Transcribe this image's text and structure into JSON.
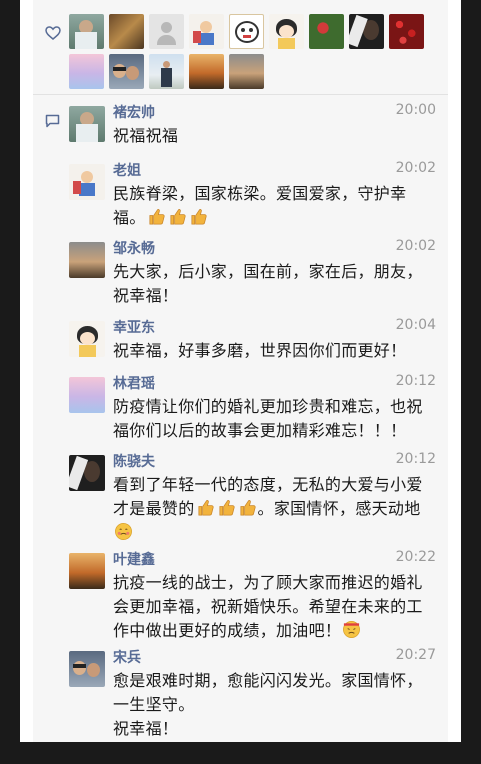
{
  "colors": {
    "name": "#576b95",
    "time": "#9a9a9a",
    "panel": "#f6f6f6",
    "accent": "#3a6fb5"
  },
  "likes": {
    "icon": "heart-outline-icon",
    "avatars": [
      "avatar-soccer-player",
      "avatar-horse-painting",
      "avatar-default-gray",
      "avatar-cartoon-superhero",
      "avatar-cartoon-face",
      "avatar-cartoon-girl",
      "avatar-red-flowers",
      "avatar-dark-portrait",
      "avatar-red-berries",
      "avatar-pastel-sky",
      "avatar-selfie-couple",
      "avatar-man-standing",
      "avatar-sunset-field",
      "avatar-cloudy-sunset"
    ]
  },
  "comments_icon": "comment-bubble-icon",
  "comments": [
    {
      "name": "褚宏帅",
      "time": "20:00",
      "lines": [
        "祝福祝福"
      ],
      "avatar": "avatar-soccer-player"
    },
    {
      "name": "老姐",
      "time": "20:02",
      "lines": [
        "民族脊梁，国家栋梁。爱国爱家，守护幸",
        "福。"
      ],
      "avatar": "avatar-cartoon-superhero",
      "emoji": "thumbs-up-emoji x3"
    },
    {
      "name": "邹永畅",
      "time": "20:02",
      "lines": [
        "先大家，后小家，国在前，家在后，朋友，",
        "祝幸福！"
      ],
      "avatar": "avatar-cloudy-sunset"
    },
    {
      "name": "幸亚东",
      "time": "20:04",
      "lines": [
        "祝幸福，好事多磨，世界因你们而更好！"
      ],
      "avatar": "avatar-cartoon-girl"
    },
    {
      "name": "林君瑶",
      "time": "20:12",
      "lines": [
        "防疫情让你们的婚礼更加珍贵和难忘，也祝",
        "福你们以后的故事会更加精彩难忘！！！"
      ],
      "avatar": "avatar-pastel-sky"
    },
    {
      "name": "陈骁夫",
      "time": "20:12",
      "lines": [
        "看到了年轻一代的态度，无私的大爱与小爱",
        "才是最赞的",
        "。家国情怀，感天动地"
      ],
      "avatar": "avatar-dark-portrait",
      "emoji": "thumbs-up-emoji x3, moved-emoji"
    },
    {
      "name": "叶建鑫",
      "time": "20:22",
      "lines": [
        "抗疫一线的战士，为了顾大家而推迟的婚礼",
        "会更加幸福，祝新婚快乐。希望在未来的工",
        "作中做出更好的成绩，加油吧！"
      ],
      "avatar": "avatar-sunset-field",
      "emoji": "flexed-emoji"
    },
    {
      "name": "宋兵",
      "time": "20:27",
      "lines": [
        "愈是艰难时期，愈能闪闪发光。家国情怀，",
        "一生坚守。",
        "祝幸福！"
      ],
      "avatar": "avatar-selfie-couple"
    }
  ]
}
